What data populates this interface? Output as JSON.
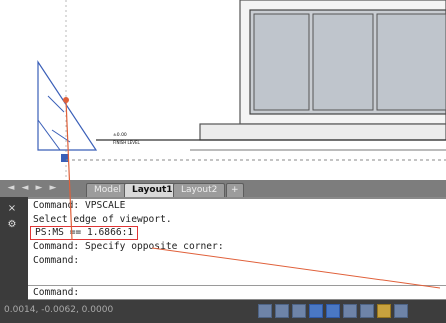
{
  "canvas": {
    "drawing_label_line1": "±0.00",
    "drawing_label_line2": "FINISH LEVEL"
  },
  "tabs": {
    "nav_arrows": [
      "◄",
      "◄",
      "►",
      "►"
    ],
    "model": "Model",
    "layout1": "Layout1",
    "layout2": "Layout2",
    "add": "+"
  },
  "command": {
    "close_glyph": "×",
    "settings_glyph": "⚙",
    "history": [
      "Command: VPSCALE",
      "Select edge of viewport.",
      "PS:MS == 1.6866:1",
      "Command: Specify opposite corner:",
      "Command:"
    ],
    "input_value": "Command:"
  },
  "status": {
    "coordinates": "0.0014, -0.0062, 0.0000",
    "icons": [
      "model-space-icon",
      "grid-icon",
      "ortho-icon",
      "polar-icon",
      "osnap-icon",
      "otrack-icon",
      "lineweight-icon",
      "workspace-icon",
      "lock-icon"
    ]
  },
  "colors": {
    "highlight_box": "#e03535",
    "annotation_line": "#e0603a",
    "viewport_blue": "#3a5fb8"
  }
}
